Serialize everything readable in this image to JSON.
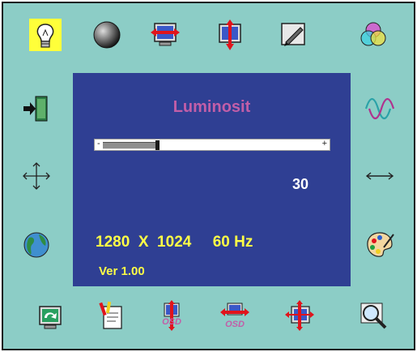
{
  "menu": {
    "title": "Luminosit",
    "slider": {
      "minus": "-",
      "plus": "+",
      "level_percent": 24
    },
    "value": "30",
    "resolution": "1280  X  1024     60 Hz",
    "version": "Ver 1.00"
  },
  "icons": {
    "osd_label": "OSD",
    "selected": "brightness-icon"
  },
  "colors": {
    "background": "#8ccdc6",
    "panel": "#2f3f93",
    "title": "#c25ea8",
    "text": "#ffff46",
    "highlight": "#ffff3a",
    "accent_red": "#e0141c"
  }
}
